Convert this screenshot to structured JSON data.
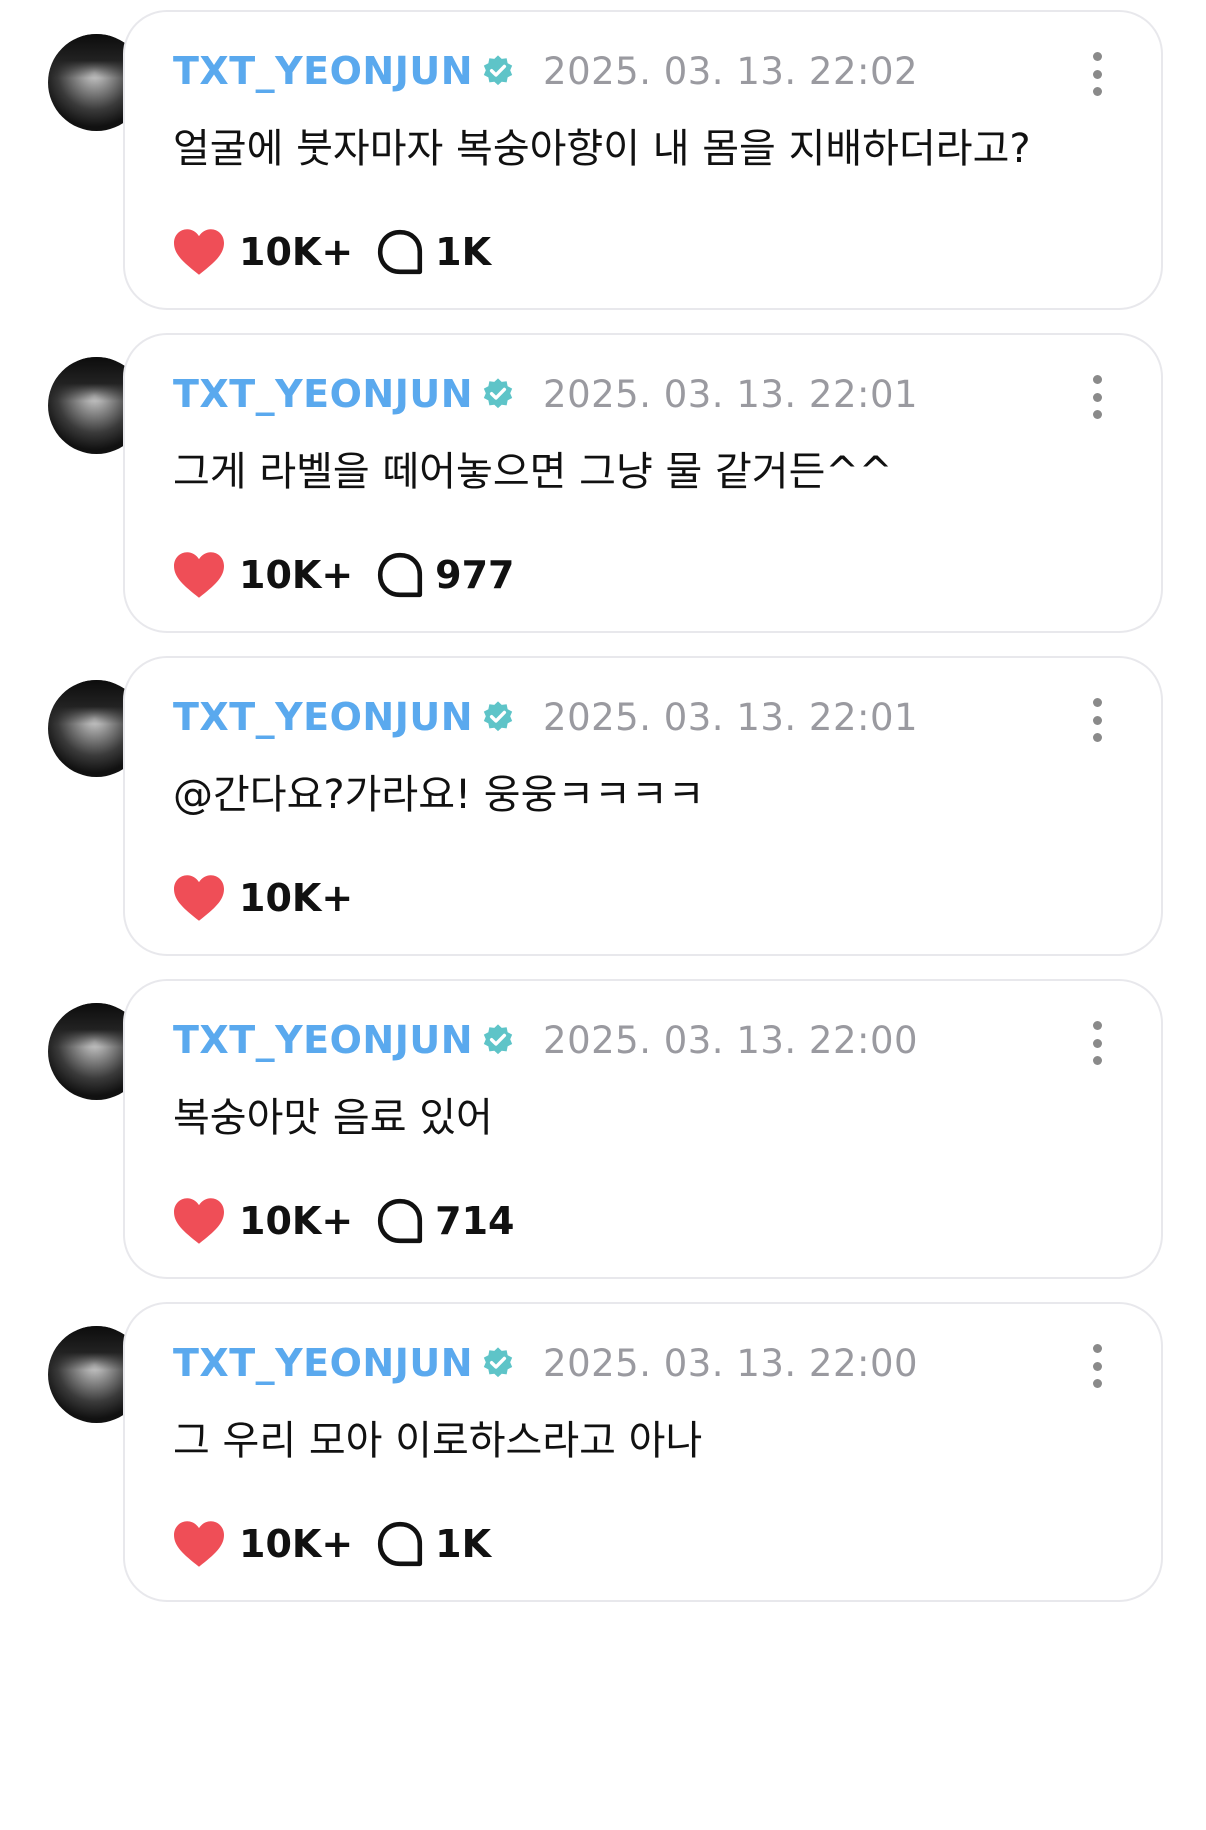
{
  "colors": {
    "username": "#5aa9ee",
    "verified": "#5ec4c8",
    "heart": "#ef4e57",
    "date": "#9a9aa0"
  },
  "posts": [
    {
      "username": "TXT_YEONJUN",
      "date": "2025. 03. 13. 22:02",
      "text": "얼굴에 붓자마자 복숭아향이 내 몸을 지배하더라고?",
      "likes": "10K+",
      "comments": "1K"
    },
    {
      "username": "TXT_YEONJUN",
      "date": "2025. 03. 13. 22:01",
      "text": "그게 라벨을 떼어놓으면 그냥 물 같거든^^",
      "likes": "10K+",
      "comments": "977"
    },
    {
      "username": "TXT_YEONJUN",
      "date": "2025. 03. 13. 22:01",
      "text": "@간다요?가라요! 웅웅ㅋㅋㅋㅋ",
      "likes": "10K+",
      "comments": null
    },
    {
      "username": "TXT_YEONJUN",
      "date": "2025. 03. 13. 22:00",
      "text": "복숭아맛 음료 있어",
      "likes": "10K+",
      "comments": "714"
    },
    {
      "username": "TXT_YEONJUN",
      "date": "2025. 03. 13. 22:00",
      "text": "그 우리 모아 이로하스라고 아나",
      "likes": "10K+",
      "comments": "1K"
    }
  ]
}
